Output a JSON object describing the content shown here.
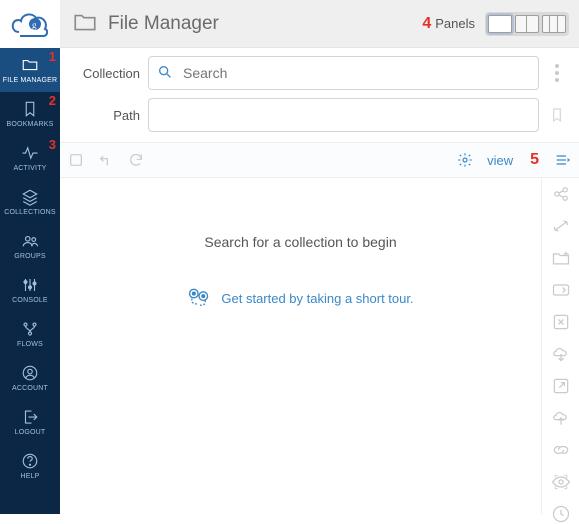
{
  "app": {
    "title": "File Manager"
  },
  "panels": {
    "label": "Panels",
    "annotation": "4"
  },
  "sidebar": {
    "items": [
      {
        "label": "FILE MANAGER",
        "annotation": "1"
      },
      {
        "label": "BOOKMARKS",
        "annotation": "2"
      },
      {
        "label": "ACTIVITY",
        "annotation": "3"
      },
      {
        "label": "COLLECTIONS"
      },
      {
        "label": "GROUPS"
      },
      {
        "label": "CONSOLE"
      },
      {
        "label": "FLOWS"
      },
      {
        "label": "ACCOUNT"
      },
      {
        "label": "LOGOUT"
      },
      {
        "label": "HELP"
      }
    ]
  },
  "inputs": {
    "collection_label": "Collection",
    "search_placeholder": "Search",
    "path_label": "Path",
    "path_value": ""
  },
  "toolbar": {
    "view_label": "view",
    "view_annotation": "5"
  },
  "content": {
    "prompt": "Search for a collection to begin",
    "tour_text": "Get started by taking a short tour."
  }
}
